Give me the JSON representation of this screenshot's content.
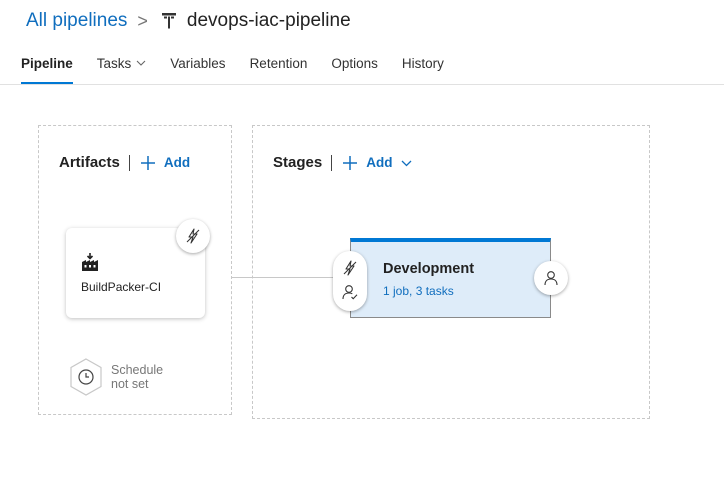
{
  "header": {
    "breadcrumb_link": "All pipelines",
    "separator": ">",
    "pipeline_name": "devops-iac-pipeline",
    "pipeline_icon": "release-pipeline-icon"
  },
  "tabs": [
    {
      "label": "Pipeline",
      "active": true
    },
    {
      "label": "Tasks",
      "has_dropdown": true
    },
    {
      "label": "Variables"
    },
    {
      "label": "Retention"
    },
    {
      "label": "Options"
    },
    {
      "label": "History"
    }
  ],
  "artifacts": {
    "title": "Artifacts",
    "add_label": "Add",
    "items": [
      {
        "name": "BuildPacker-CI",
        "icon": "build-artifact-icon"
      }
    ],
    "schedule_text": "Schedule not set"
  },
  "stages": {
    "title": "Stages",
    "add_label": "Add",
    "items": [
      {
        "name": "Development",
        "summary": "1 job, 3 tasks"
      }
    ]
  },
  "colors": {
    "accent": "#0078d4",
    "link": "#106ebe",
    "stage_fill": "#deecf9"
  }
}
